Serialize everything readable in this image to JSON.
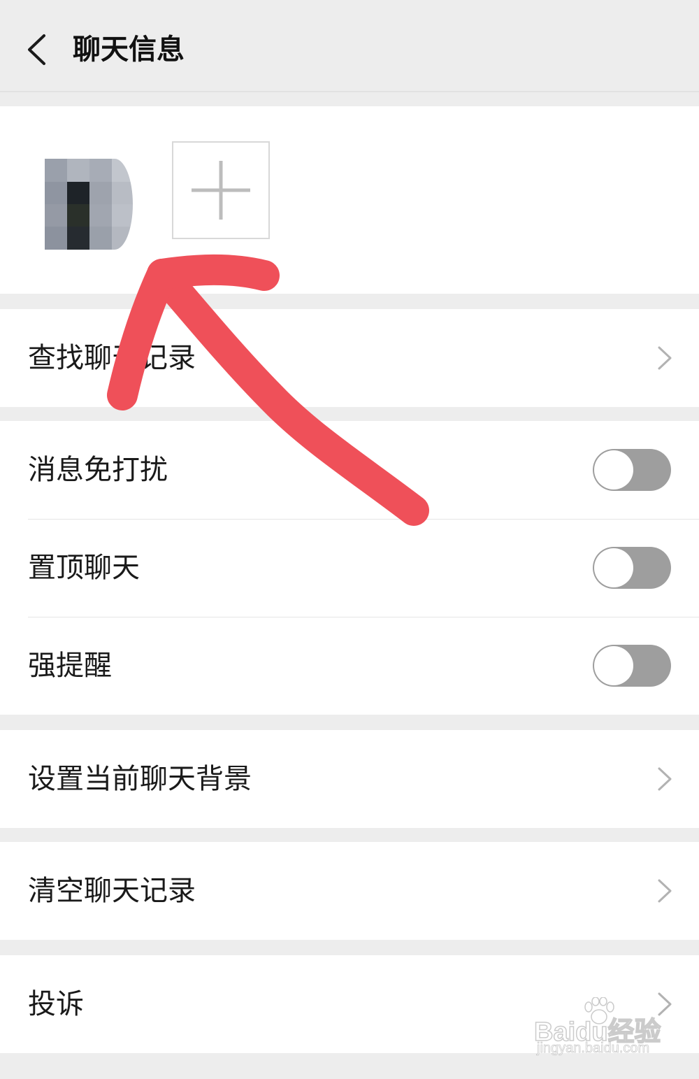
{
  "header": {
    "title": "聊天信息",
    "back_icon": "chevron-left-icon"
  },
  "members": {
    "add_icon": "plus-icon"
  },
  "settings": {
    "search_history": {
      "label": "查找聊天记录"
    },
    "mute": {
      "label": "消息免打扰",
      "enabled": false
    },
    "pin": {
      "label": "置顶聊天",
      "enabled": false
    },
    "alert": {
      "label": "强提醒",
      "enabled": false
    },
    "background": {
      "label": "设置当前聊天背景"
    },
    "clear_history": {
      "label": "清空聊天记录"
    },
    "report": {
      "label": "投诉"
    }
  },
  "annotation": {
    "arrow_color": "#ef5059"
  },
  "watermark": {
    "main": "Baidu经验",
    "sub": "jingyan.baidu.com"
  },
  "colors": {
    "page_bg": "#ededed",
    "card_bg": "#ffffff",
    "toggle_off": "#9e9e9e",
    "chevron": "#b2b2b2"
  }
}
